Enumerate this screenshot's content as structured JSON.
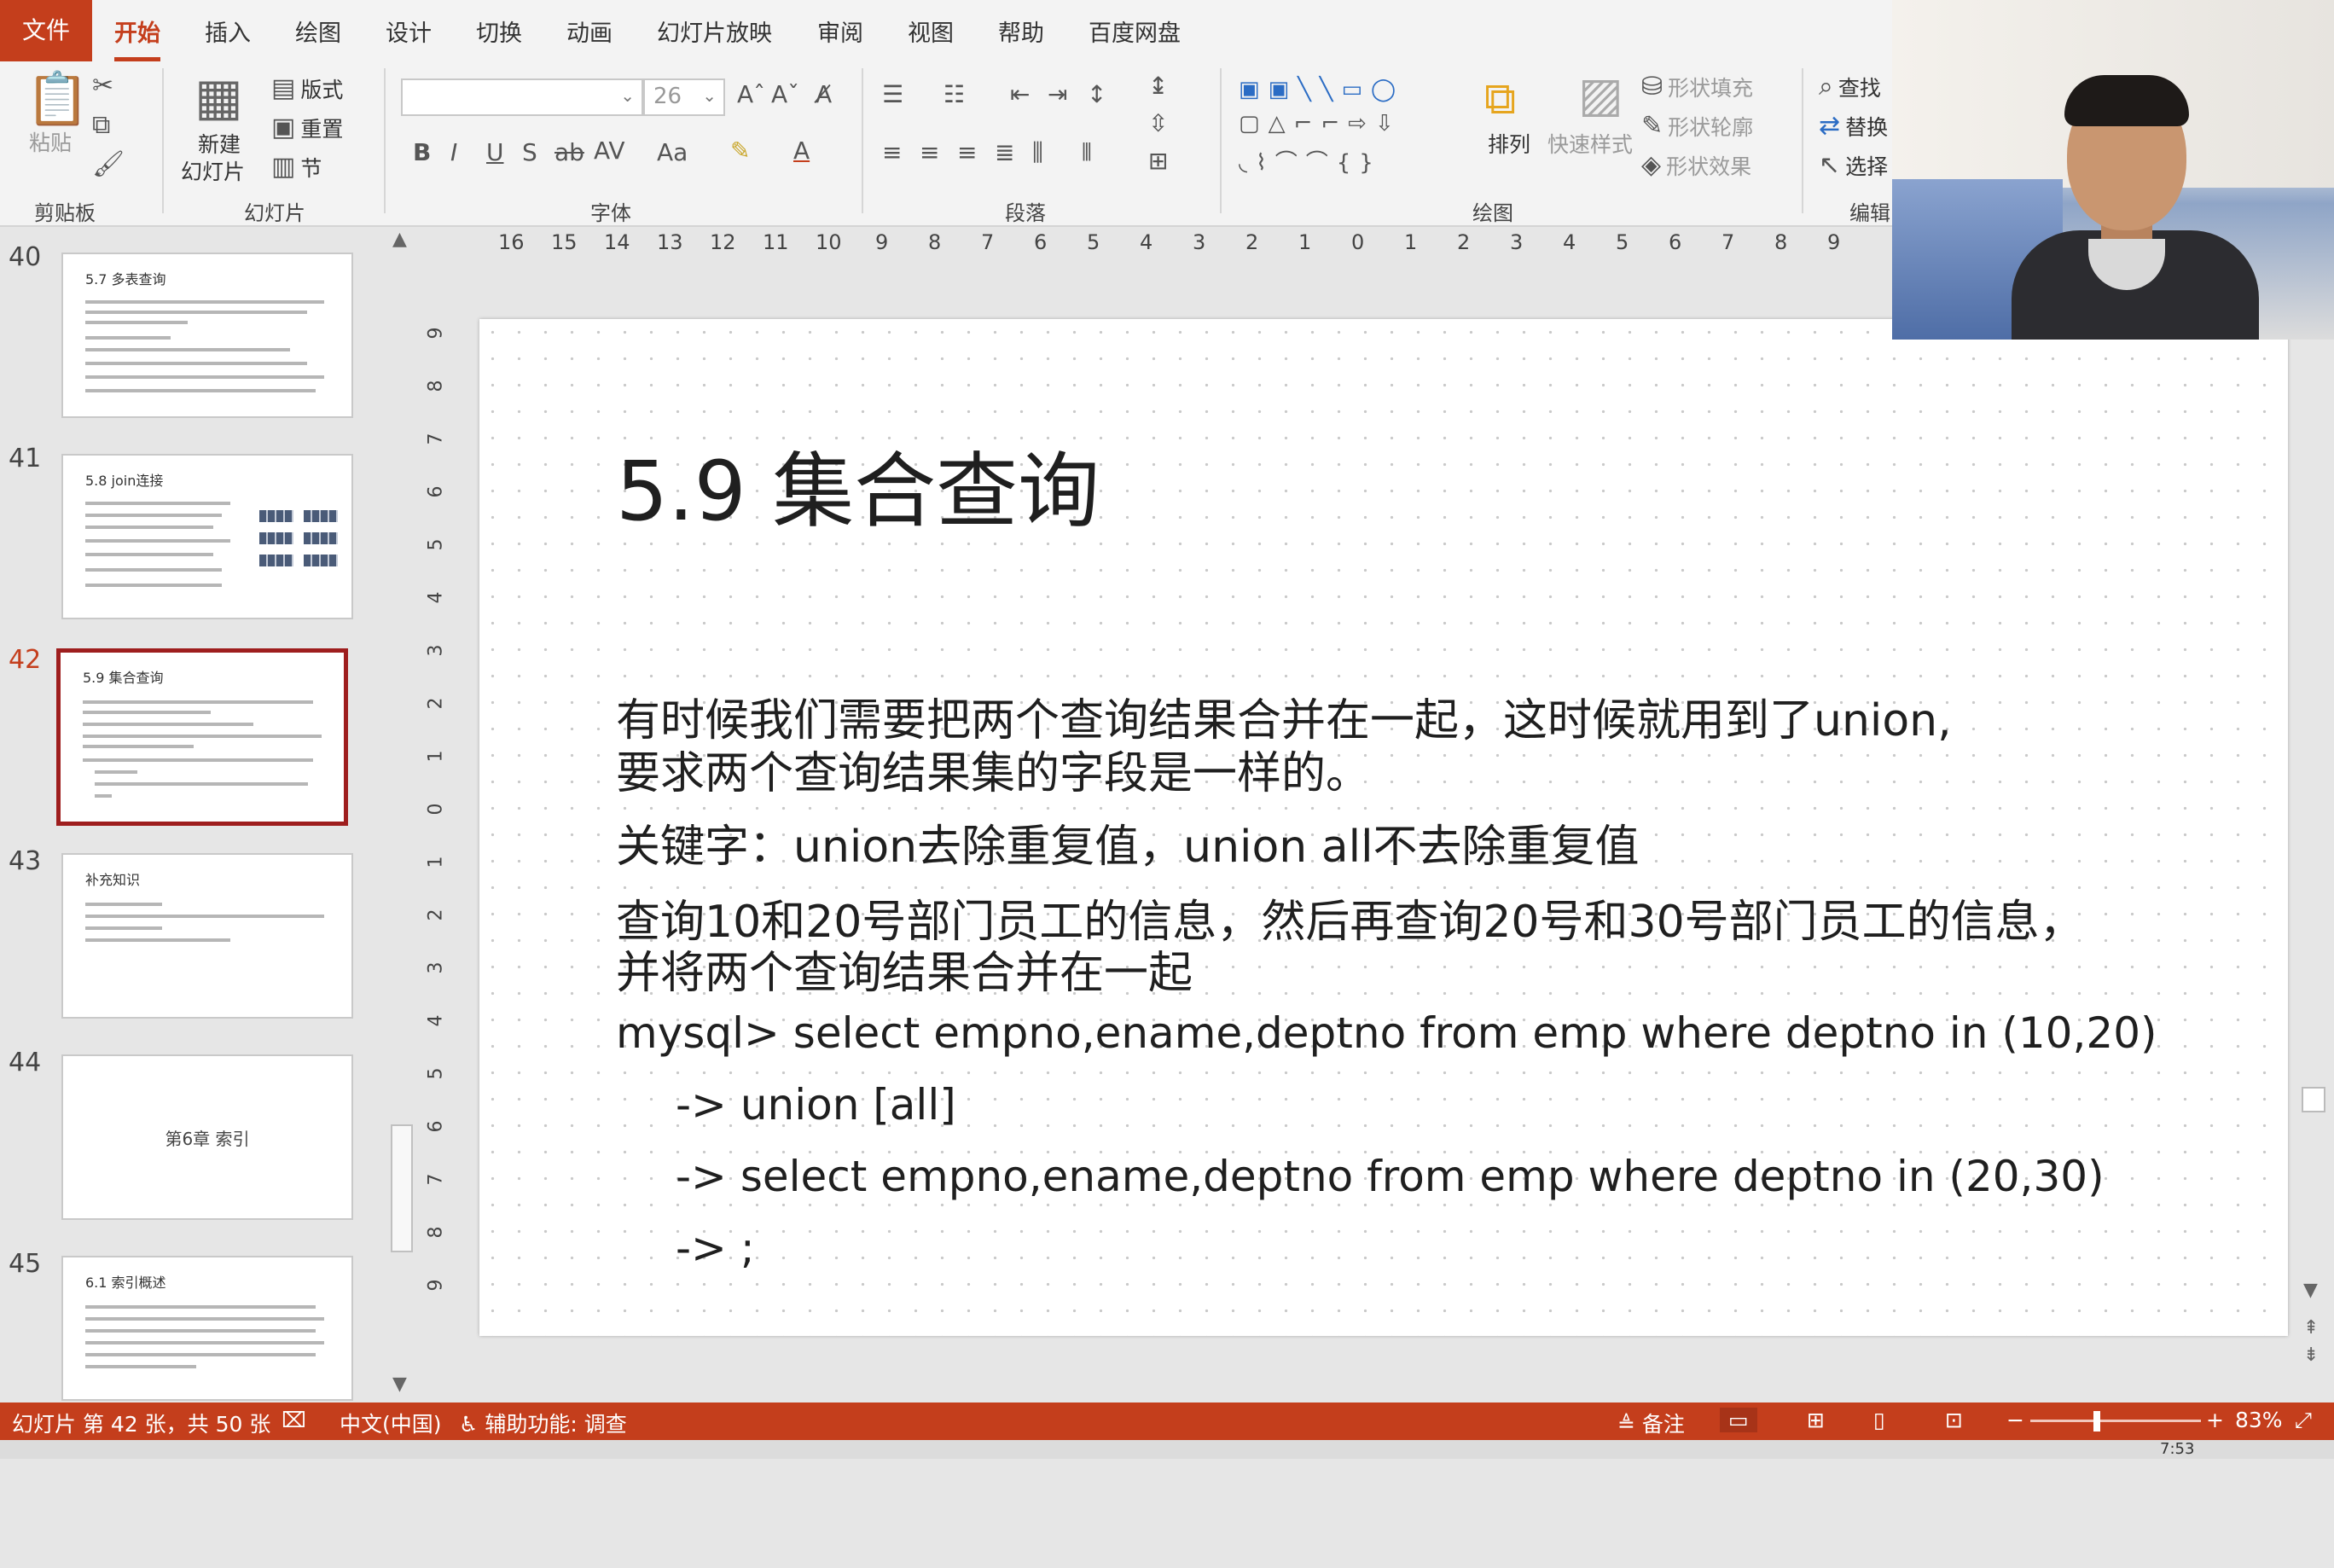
{
  "ribbon_tabs": [
    "文件",
    "开始",
    "插入",
    "绘图",
    "设计",
    "切换",
    "动画",
    "幻灯片放映",
    "审阅",
    "视图",
    "帮助",
    "百度网盘"
  ],
  "ribbon": {
    "clipboard": {
      "paste": "粘贴",
      "group": "剪贴板"
    },
    "slides": {
      "new_slide_1": "新建",
      "new_slide_2": "幻灯片",
      "layout": "版式",
      "reset": "重置",
      "section": "节",
      "group": "幻灯片"
    },
    "font": {
      "font_name": "",
      "font_size": "26",
      "group": "字体"
    },
    "paragraph": {
      "group": "段落"
    },
    "drawing": {
      "arrange": "排列",
      "quick_styles": "快速样式",
      "shape_fill": "形状填充",
      "shape_outline": "形状轮廓",
      "shape_effects": "形状效果",
      "group": "绘图"
    },
    "editing": {
      "find": "查找",
      "replace": "替换",
      "select": "选择",
      "group": "编辑"
    }
  },
  "thumbnails": [
    {
      "num": "40",
      "title": "5.7 多表查询"
    },
    {
      "num": "41",
      "title": "5.8 join连接"
    },
    {
      "num": "42",
      "title": "5.9 集合查询"
    },
    {
      "num": "43",
      "title": "补充知识"
    },
    {
      "num": "44",
      "title": "第6章 索引"
    },
    {
      "num": "45",
      "title": "6.1 索引概述"
    }
  ],
  "ruler_h": [
    "16",
    "15",
    "14",
    "13",
    "12",
    "11",
    "10",
    "9",
    "8",
    "7",
    "6",
    "5",
    "4",
    "3",
    "2",
    "1",
    "0",
    "1",
    "2",
    "3",
    "4",
    "5",
    "6",
    "7",
    "8",
    "9"
  ],
  "ruler_v": [
    "9",
    "8",
    "7",
    "6",
    "5",
    "4",
    "3",
    "2",
    "1",
    "0",
    "1",
    "2",
    "3",
    "4",
    "5",
    "6",
    "7",
    "8",
    "9"
  ],
  "slide": {
    "title": "5.9 集合查询",
    "line1": "有时候我们需要把两个查询结果合并在一起，这时候就用到了union,",
    "line2": "要求两个查询结果集的字段是一样的。",
    "line3": "关键字：union去除重复值，union all不去除重复值",
    "line4": "查询10和20号部门员工的信息，然后再查询20号和30号部门员工的信息，",
    "line5": "并将两个查询结果合并在一起",
    "code1": "mysql> select empno,ename,deptno from emp where deptno in (10,20)",
    "code2": "-> union [all]",
    "code3": "-> select empno,ename,deptno from emp where deptno in (20,30)",
    "code4": "-> ;"
  },
  "status": {
    "slide_info": "幻灯片 第 42 张，共 50 张",
    "language": "中文(中国)",
    "accessibility": "辅助功能: 调查",
    "notes": "备注",
    "zoom": "83%"
  },
  "clock": "7:53",
  "colors": {
    "accent": "#c43e1c",
    "current_thumb_border": "#9e1e1e"
  }
}
